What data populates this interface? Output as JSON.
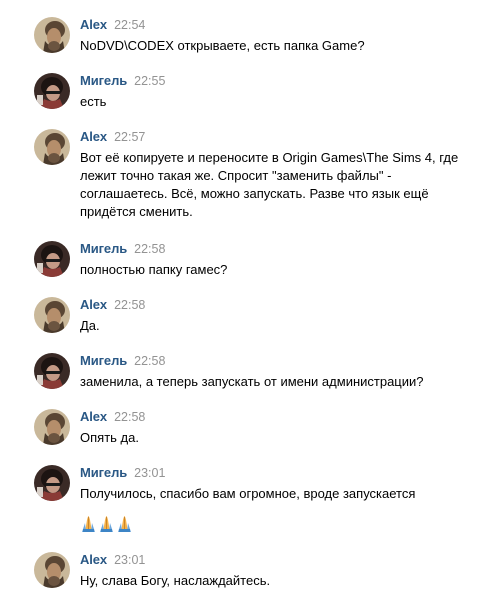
{
  "messages": [
    {
      "author": "Alex",
      "time": "22:54",
      "avatar": "alex-avatar",
      "text": "NoDVD\\CODEX открываете, есть папка Game?"
    },
    {
      "author": "Мигель",
      "time": "22:55",
      "avatar": "migel-avatar",
      "text": "есть"
    },
    {
      "author": "Alex",
      "time": "22:57",
      "avatar": "alex-avatar",
      "text": "Вот её копируете и переносите в Origin Games\\The Sims 4, где лежит точно такая же. Спросит \"заменить файлы\" - соглашаетесь. Всё, можно запускать. Разве что язык ещё придётся сменить."
    },
    {
      "author": "Мигель",
      "time": "22:58",
      "avatar": "migel-avatar",
      "text": "полностью папку гамес?"
    },
    {
      "author": "Alex",
      "time": "22:58",
      "avatar": "alex-avatar",
      "text": "Да."
    },
    {
      "author": "Мигель",
      "time": "22:58",
      "avatar": "migel-avatar",
      "text": "заменила, а теперь запускать от имени администрации?"
    },
    {
      "author": "Alex",
      "time": "22:58",
      "avatar": "alex-avatar",
      "text": "Опять да."
    },
    {
      "author": "Мигель",
      "time": "23:01",
      "avatar": "migel-avatar",
      "text": "Получилось, спасибо вам огромное, вроде запускается",
      "emoji": [
        "folded-hands",
        "folded-hands",
        "folded-hands"
      ]
    },
    {
      "author": "Alex",
      "time": "23:01",
      "avatar": "alex-avatar",
      "text": "Ну, слава Богу, наслаждайтесь."
    }
  ],
  "colors": {
    "author": "#2a5885",
    "time": "#939393",
    "text": "#000000",
    "background": "#ffffff"
  }
}
